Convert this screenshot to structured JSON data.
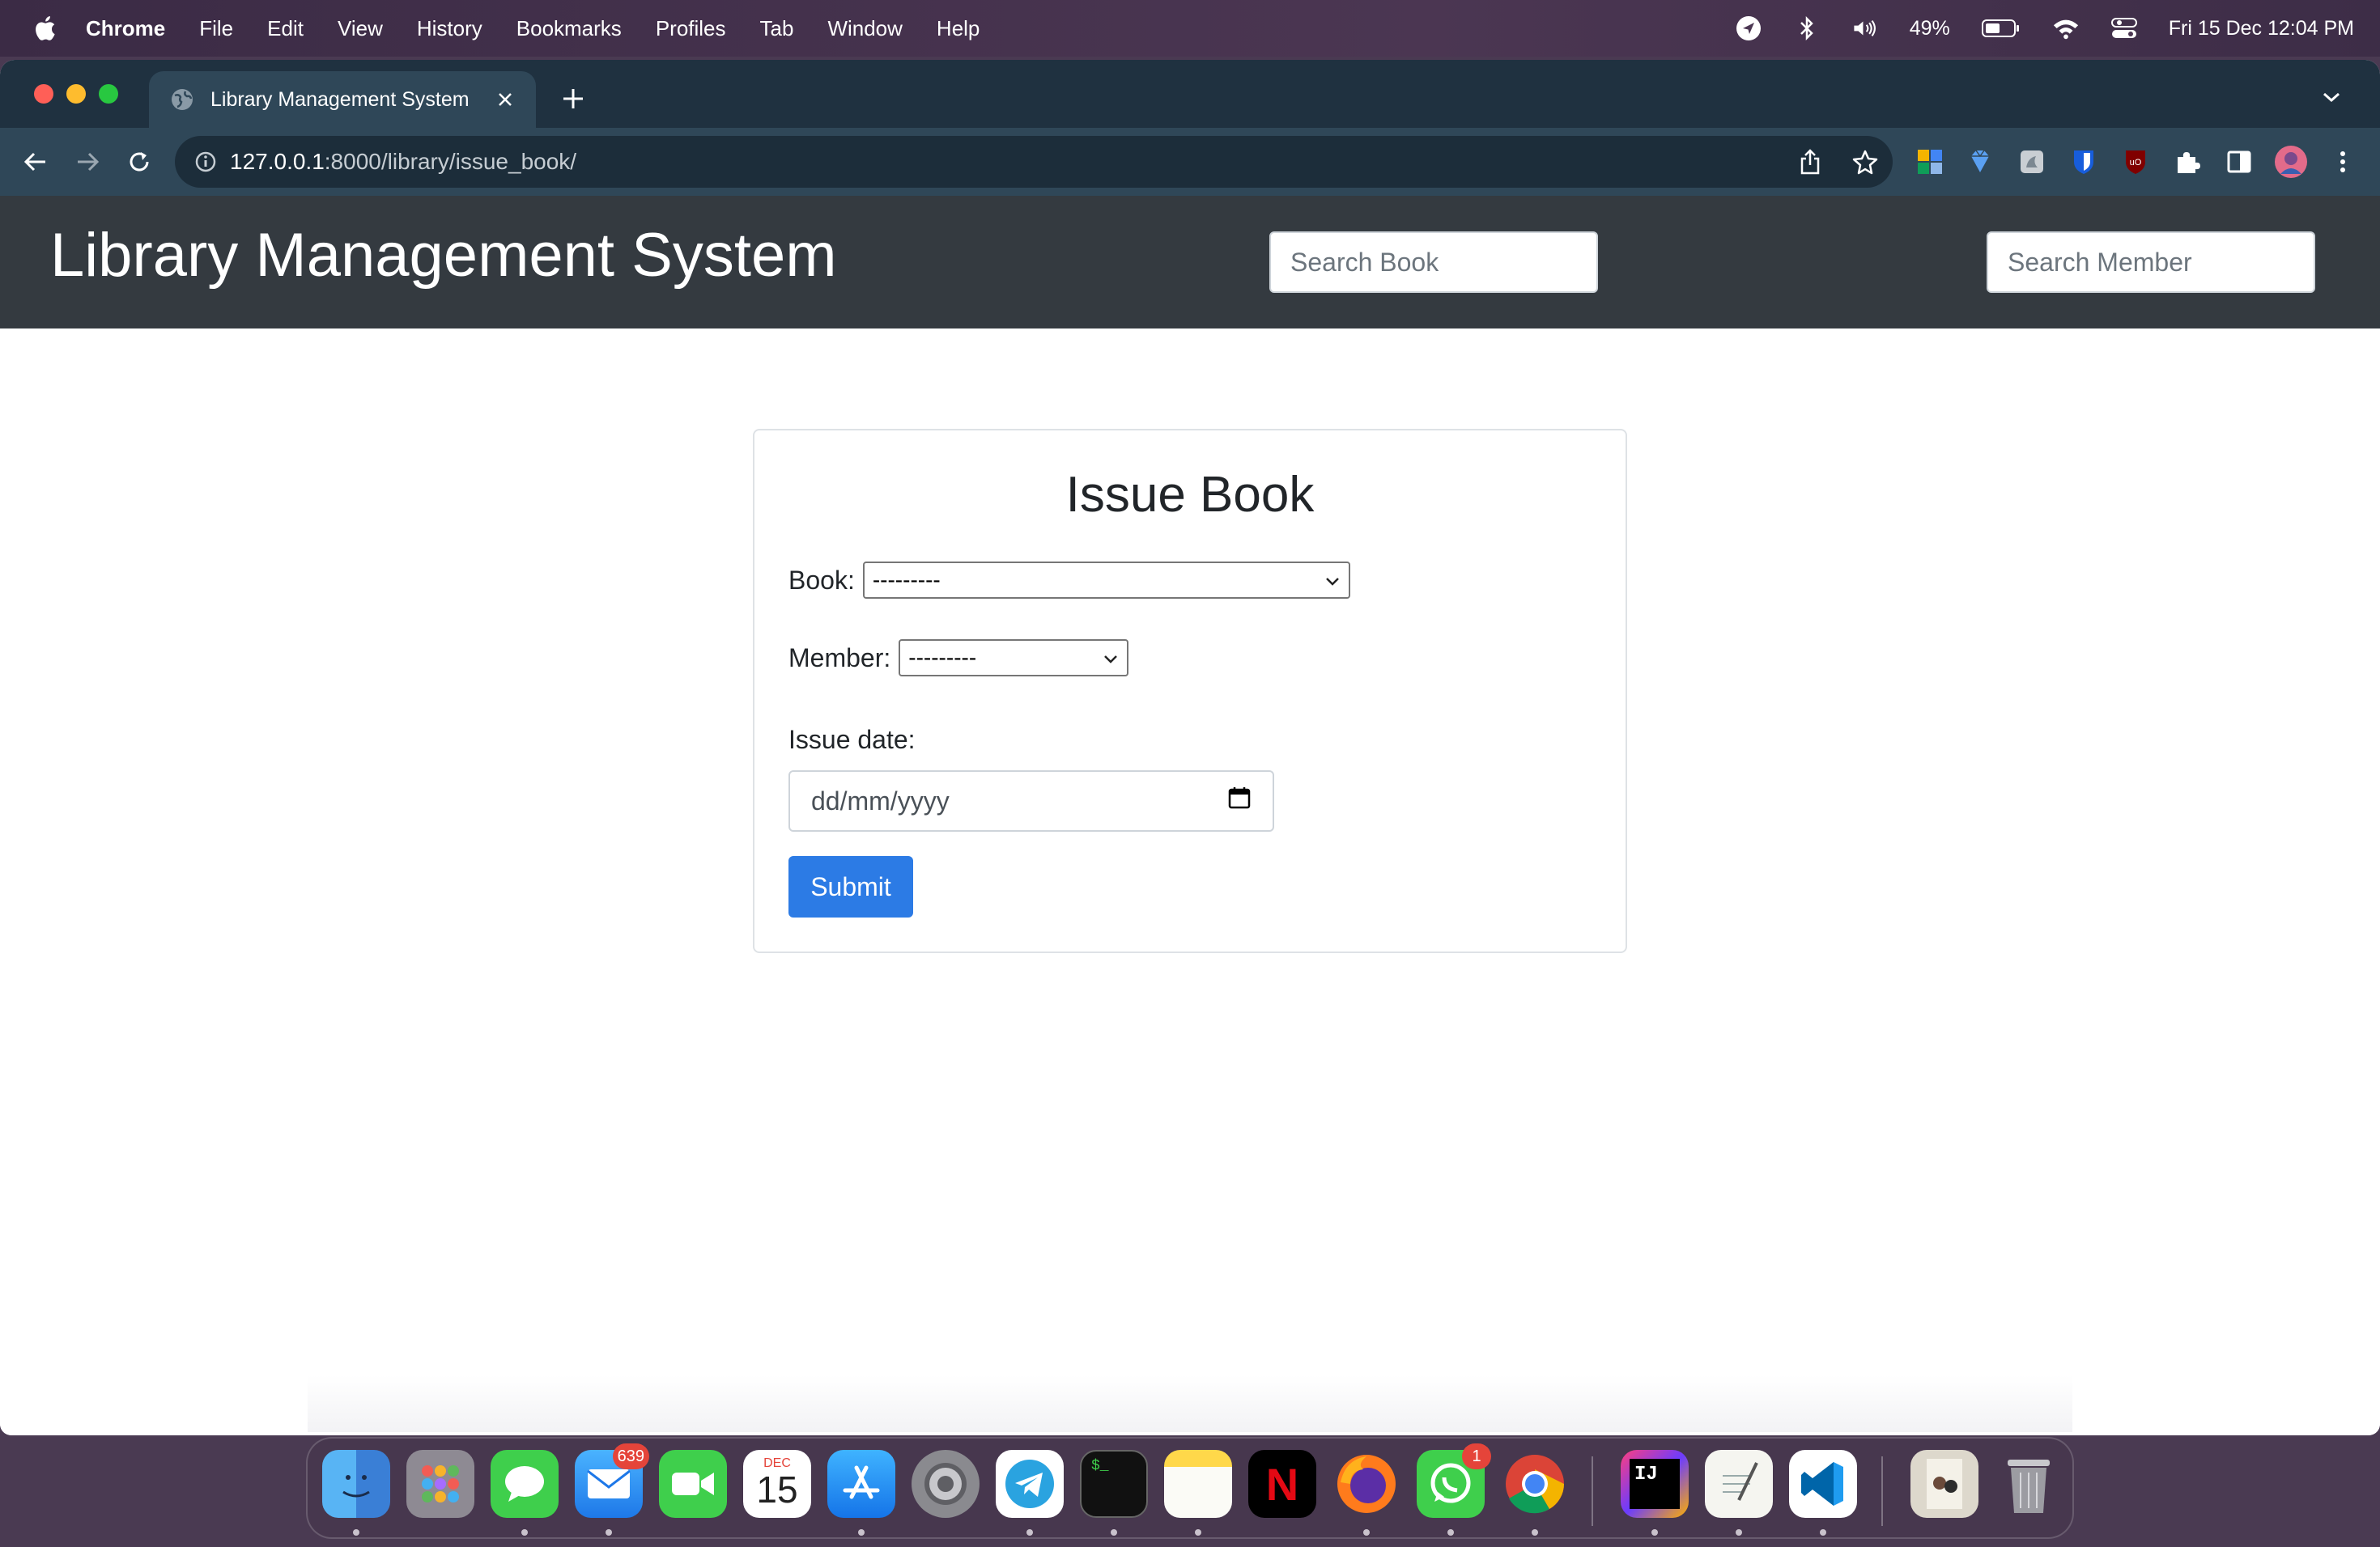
{
  "menubar": {
    "app_name": "Chrome",
    "items": [
      "File",
      "Edit",
      "View",
      "History",
      "Bookmarks",
      "Profiles",
      "Tab",
      "Window",
      "Help"
    ],
    "battery": "49%",
    "datetime": "Fri 15 Dec  12:04 PM"
  },
  "browser": {
    "tab_title": "Library Management System",
    "url_host": "127.0.0.1",
    "url_rest": ":8000/library/issue_book/"
  },
  "navbar": {
    "brand": "Library Management System",
    "search_book_placeholder": "Search Book",
    "search_member_placeholder": "Search Member"
  },
  "form": {
    "title": "Issue Book",
    "book_label": "Book:",
    "book_selected": "---------",
    "member_label": "Member:",
    "member_selected": "---------",
    "issue_date_label": "Issue date:",
    "issue_date_placeholder": "dd/mm/yyyy",
    "submit_label": "Submit"
  },
  "dock": {
    "mail_badge": "639",
    "whatsapp_badge": "1",
    "calendar_month": "DEC",
    "calendar_day": "15"
  },
  "colors": {
    "navbar_bg": "#343a40",
    "primary": "#2c7be5",
    "chrome_frame": "#1f3140",
    "chrome_toolbar": "#2f4758"
  }
}
